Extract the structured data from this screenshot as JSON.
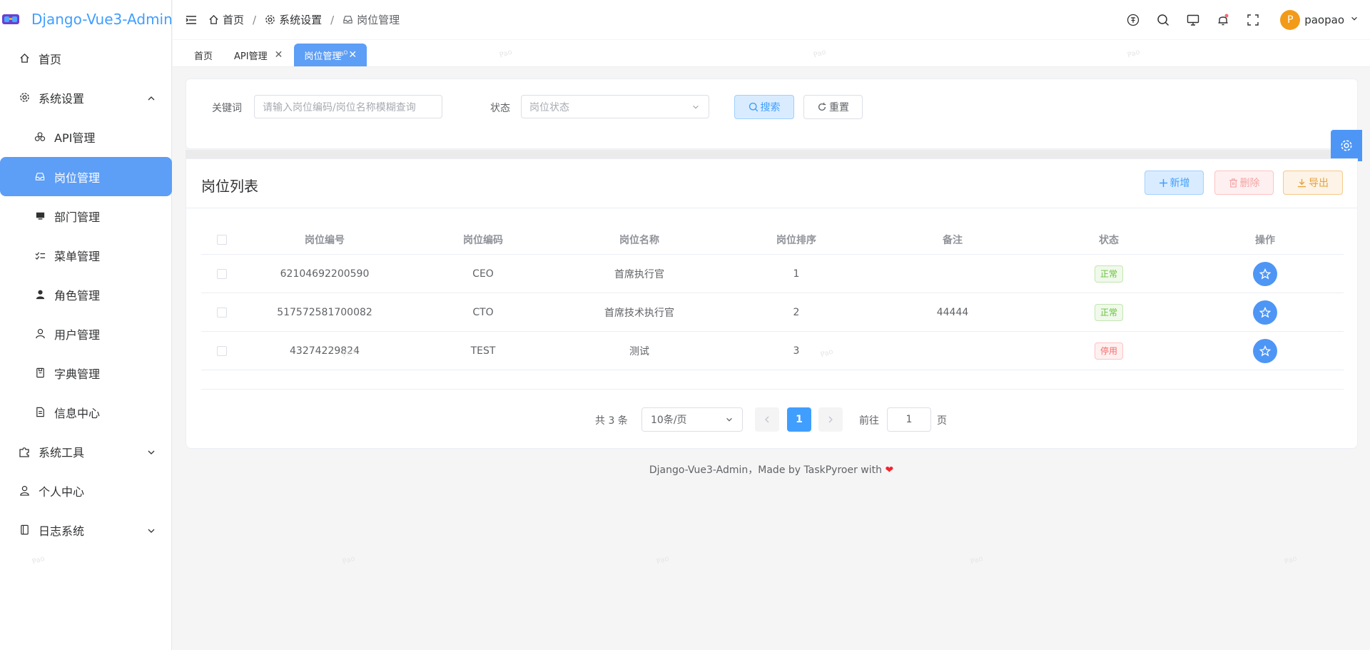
{
  "app": {
    "logo_text": "Django-Vue3-Admin"
  },
  "sidebar": {
    "items": [
      {
        "label": "首页",
        "icon": "home-icon",
        "level": 1
      },
      {
        "label": "系统设置",
        "icon": "gear-icon",
        "level": 1,
        "expanded": true
      },
      {
        "label": "API管理",
        "icon": "cluster-icon",
        "level": 2
      },
      {
        "label": "岗位管理",
        "icon": "inbox-icon",
        "level": 2,
        "active": true
      },
      {
        "label": "部门管理",
        "icon": "monitor-icon",
        "level": 2
      },
      {
        "label": "菜单管理",
        "icon": "checklist-icon",
        "level": 2
      },
      {
        "label": "角色管理",
        "icon": "user-filled-icon",
        "level": 2
      },
      {
        "label": "用户管理",
        "icon": "user-icon",
        "level": 2
      },
      {
        "label": "字典管理",
        "icon": "notebook-icon",
        "level": 2
      },
      {
        "label": "信息中心",
        "icon": "document-icon",
        "level": 2
      },
      {
        "label": "系统工具",
        "icon": "puzzle-icon",
        "level": 1,
        "expanded": false
      },
      {
        "label": "个人中心",
        "icon": "user-outline-icon",
        "level": 1
      },
      {
        "label": "日志系统",
        "icon": "log-book-icon",
        "level": 1,
        "expanded": false
      }
    ]
  },
  "header": {
    "breadcrumb": [
      "首页",
      "系统设置",
      "岗位管理"
    ],
    "separator": "/",
    "icons": [
      "language-icon",
      "search-icon",
      "monitor-icon",
      "bell-icon",
      "fullscreen-icon"
    ],
    "user": {
      "avatar_letter": "P",
      "name": "paopao"
    }
  },
  "tabs": [
    {
      "label": "首页",
      "closable": false
    },
    {
      "label": "API管理",
      "closable": true
    },
    {
      "label": "岗位管理",
      "closable": true,
      "active": true
    }
  ],
  "search": {
    "keyword_label": "关键词",
    "keyword_placeholder": "请输入岗位编码/岗位名称模糊查询",
    "status_label": "状态",
    "status_placeholder": "岗位状态",
    "search_button": "搜索",
    "reset_button": "重置"
  },
  "list": {
    "title": "岗位列表",
    "add_button": "新增",
    "delete_button": "删除",
    "export_button": "导出",
    "columns": [
      "岗位编号",
      "岗位编码",
      "岗位名称",
      "岗位排序",
      "备注",
      "状态",
      "操作"
    ],
    "rows": [
      {
        "id": "62104692200590",
        "code": "CEO",
        "name": "首席执行官",
        "sort": "1",
        "remark": "",
        "status": "正常",
        "status_type": "ok"
      },
      {
        "id": "517572581700082",
        "code": "CTO",
        "name": "首席技术执行官",
        "sort": "2",
        "remark": "44444",
        "status": "正常",
        "status_type": "ok"
      },
      {
        "id": "43274229824",
        "code": "TEST",
        "name": "测试",
        "sort": "3",
        "remark": "",
        "status": "停用",
        "status_type": "stop"
      }
    ]
  },
  "pagination": {
    "total_text": "共 3 条",
    "page_size": "10条/页",
    "current_page": "1",
    "goto_label": "前往",
    "goto_value": "1",
    "page_suffix": "页"
  },
  "footer": {
    "text": "Django-Vue3-Admin，Made by TaskPyroer with",
    "heart": "❤"
  },
  "watermark": "Pao",
  "colors": {
    "primary": "#409eff",
    "active_bg": "#5d9ef6",
    "success": "#67c23a",
    "danger": "#f56c6c",
    "warning": "#e6a23c"
  }
}
